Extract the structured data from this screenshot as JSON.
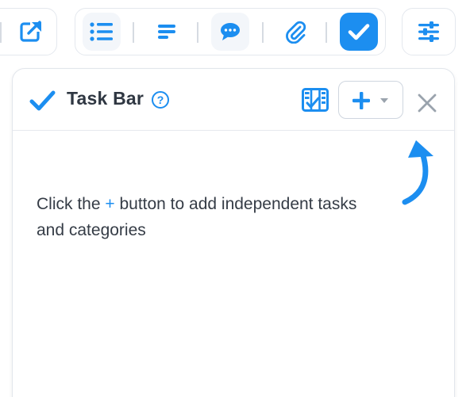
{
  "toolbar": {
    "buttons": [
      {
        "name": "open-external",
        "icon": "open-external-icon"
      },
      {
        "name": "list",
        "icon": "list-icon"
      },
      {
        "name": "text-lines",
        "icon": "text-lines-icon"
      },
      {
        "name": "comment",
        "icon": "comment-icon"
      },
      {
        "name": "attachment",
        "icon": "paperclip-icon"
      },
      {
        "name": "tasks",
        "icon": "checkmark-icon",
        "active": true
      },
      {
        "name": "settings",
        "icon": "sliders-icon"
      }
    ]
  },
  "panel": {
    "title": "Task Bar",
    "help_symbol": "?",
    "icons": {
      "title": "checkmark-icon",
      "board": "task-board-icon",
      "add": "plus-icon",
      "add_menu": "caret-down-icon",
      "close": "close-icon"
    },
    "hint_before": "Click the ",
    "hint_plus": "+",
    "hint_after": " button to add independent tasks and categories"
  },
  "colors": {
    "accent": "#1c8ef0",
    "text": "#353c46",
    "title": "#2f3742",
    "muted": "#9aa3ad",
    "border": "#e2e6ec"
  }
}
